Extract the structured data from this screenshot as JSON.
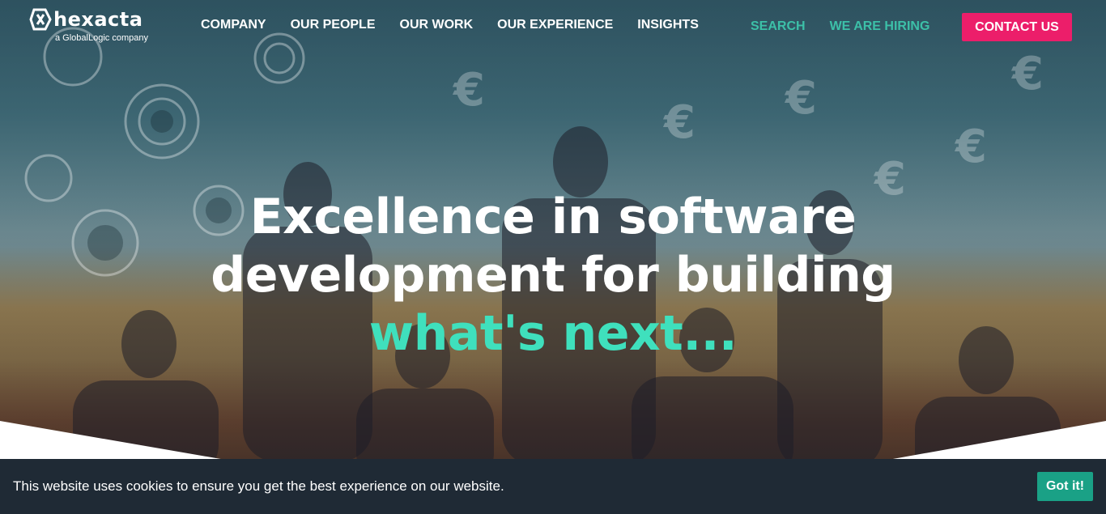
{
  "brand": {
    "logo_text": "hexacta",
    "logo_sub": "a GlobalLogic company"
  },
  "nav": {
    "items": [
      "COMPANY",
      "OUR PEOPLE",
      "OUR WORK",
      "OUR EXPERIENCE",
      "INSIGHTS"
    ],
    "search": "SEARCH",
    "hiring": "WE ARE HIRING",
    "contact": "CONTACT US"
  },
  "hero": {
    "line1": "Excellence in software",
    "line2": "development for building",
    "accent": "what's next..."
  },
  "cookie": {
    "text": "This website uses cookies to ensure you get the best experience on our website.",
    "button": "Got it!"
  },
  "colors": {
    "accent": "#3fe0bd",
    "contact_button": "#ec1e6a",
    "cookie_bar": "#1f2a35",
    "cookie_button": "#1aa186"
  },
  "icons": {
    "logo": "hexacta-logo-icon"
  }
}
